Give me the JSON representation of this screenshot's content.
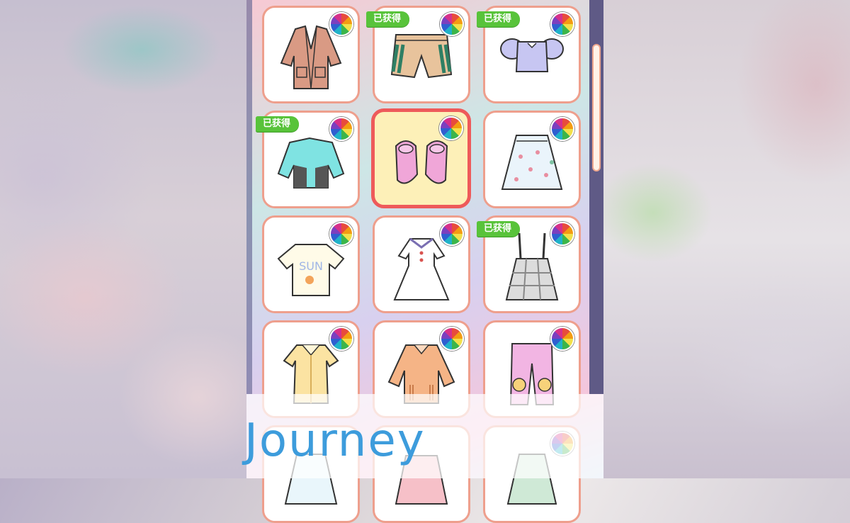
{
  "overlay_text": "Journey",
  "badge_text": "已获得",
  "grid": [
    {
      "name": "brown-coat",
      "badge": false,
      "selected": false
    },
    {
      "name": "tan-shorts",
      "badge": true,
      "selected": false
    },
    {
      "name": "lavender-crop-top",
      "badge": true,
      "selected": false
    },
    {
      "name": "teal-jacket",
      "badge": true,
      "selected": false
    },
    {
      "name": "pink-gloves",
      "badge": false,
      "selected": true
    },
    {
      "name": "floral-skirt",
      "badge": false,
      "selected": false
    },
    {
      "name": "sun-tshirt",
      "badge": false,
      "selected": false
    },
    {
      "name": "sailor-dress",
      "badge": false,
      "selected": false
    },
    {
      "name": "plaid-suspender-skirt",
      "badge": true,
      "selected": false
    },
    {
      "name": "yellow-ruffle-dress",
      "badge": false,
      "selected": false
    },
    {
      "name": "orange-blouse",
      "badge": false,
      "selected": false
    },
    {
      "name": "pink-flower-pants",
      "badge": false,
      "selected": false
    },
    {
      "name": "white-dress-partial",
      "badge": false,
      "selected": false
    },
    {
      "name": "pink-outfit-partial",
      "badge": false,
      "selected": false
    },
    {
      "name": "green-dress-partial",
      "badge": false,
      "selected": false
    }
  ],
  "colors": {
    "card_border": "#ee9f8d",
    "selected_border": "#ee5a5a",
    "badge": "#58c33a",
    "title": "#3d9cdc"
  },
  "icons": [
    "color-wheel-icon"
  ]
}
